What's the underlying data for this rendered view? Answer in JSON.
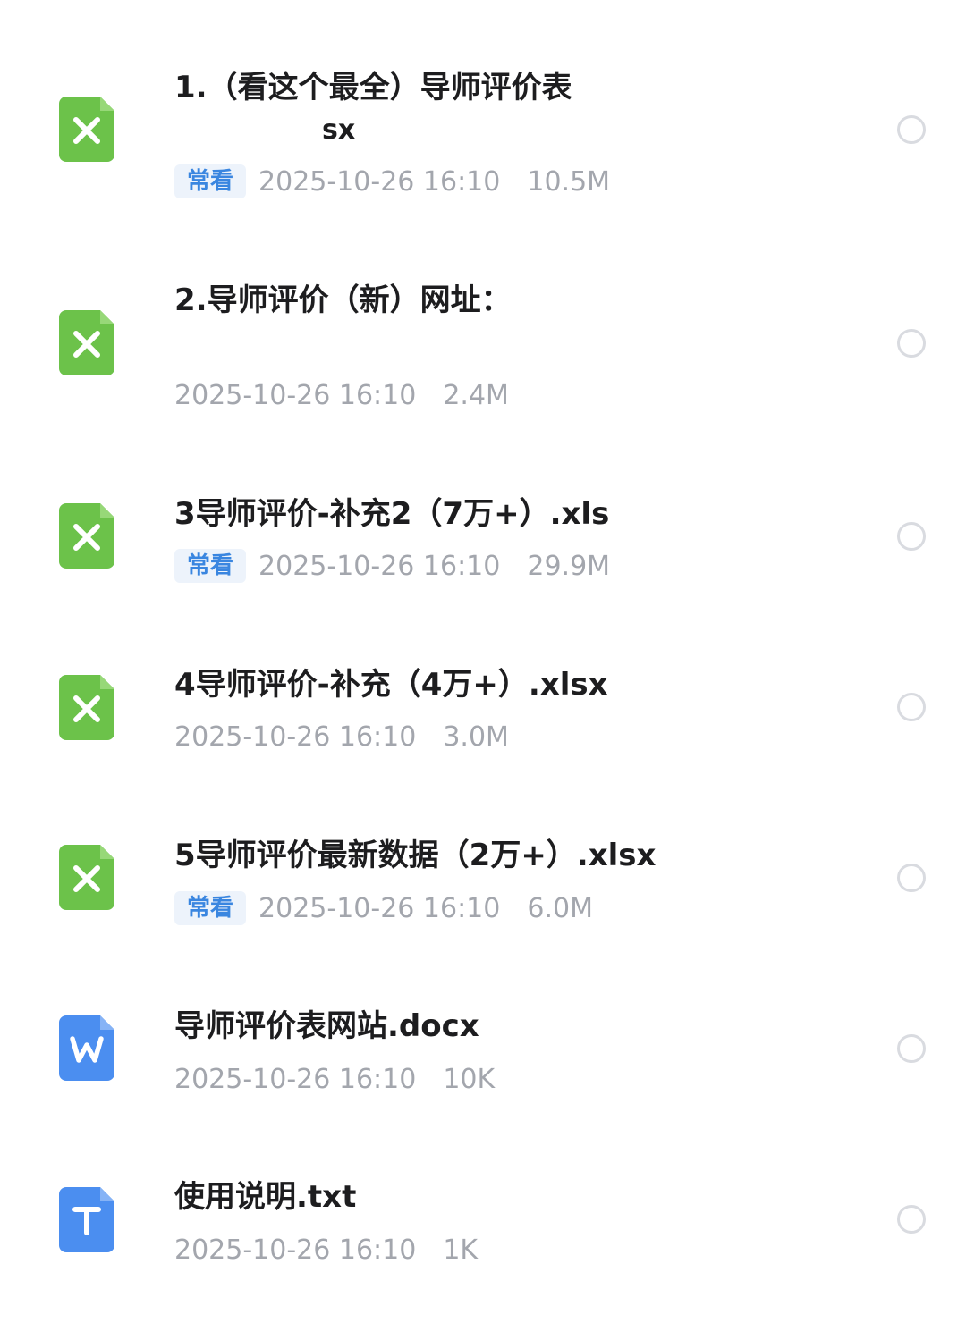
{
  "files": [
    {
      "name": "1.（看这个最全）导师评价表",
      "name_cont": "sx",
      "tag": "常看",
      "date": "2025-10-26 16:10",
      "size": "10.5M",
      "icon": "excel-icon",
      "icon_color": "#6cc24a"
    },
    {
      "name": "2.导师评价（新）网址：",
      "tag": "",
      "date": "2025-10-26 16:10",
      "size": "2.4M",
      "icon": "excel-icon",
      "icon_color": "#6cc24a"
    },
    {
      "name": "3导师评价-补充2（7万+）.xls",
      "tag": "常看",
      "date": "2025-10-26 16:10",
      "size": "29.9M",
      "icon": "excel-icon",
      "icon_color": "#6cc24a"
    },
    {
      "name": "4导师评价-补充（4万+）.xlsx",
      "tag": "",
      "date": "2025-10-26 16:10",
      "size": "3.0M",
      "icon": "excel-icon",
      "icon_color": "#6cc24a"
    },
    {
      "name": "5导师评价最新数据（2万+）.xlsx",
      "tag": "常看",
      "date": "2025-10-26 16:10",
      "size": "6.0M",
      "icon": "excel-icon",
      "icon_color": "#6cc24a"
    },
    {
      "name": "导师评价表网站.docx",
      "tag": "",
      "date": "2025-10-26 16:10",
      "size": "10K",
      "icon": "word-icon",
      "icon_color": "#4b8ef0"
    },
    {
      "name": "使用说明.txt",
      "tag": "",
      "date": "2025-10-26 16:10",
      "size": "1K",
      "icon": "text-file-icon",
      "icon_color": "#4b8ef0"
    }
  ]
}
